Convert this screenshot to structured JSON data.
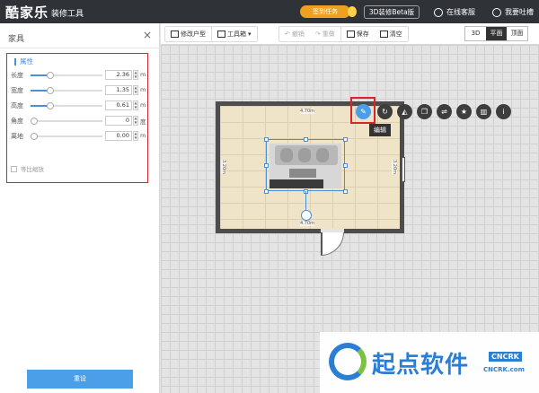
{
  "header": {
    "logo": "酷家乐",
    "subtitle": "装修工具",
    "task_label": "签到任务",
    "beta_label": "3D装修Beta版",
    "service_label": "在线客服",
    "feedback_label": "我要吐槽"
  },
  "left_panel": {
    "title": "家具",
    "close": "×",
    "attr_title": "属性",
    "rows": [
      {
        "label": "长度",
        "value": "2.36",
        "unit": "m",
        "fill": 0.28
      },
      {
        "label": "宽度",
        "value": "1.35",
        "unit": "m",
        "fill": 0.28
      },
      {
        "label": "高度",
        "value": "0.61",
        "unit": "m",
        "fill": 0.28
      },
      {
        "label": "角度",
        "value": "0",
        "unit": "度",
        "fill": 0.0
      },
      {
        "label": "离地",
        "value": "0.00",
        "unit": "m",
        "fill": 0.0
      }
    ],
    "checkbox_label": "等比缩放",
    "reset_label": "重设"
  },
  "toolbar": {
    "edit_floor": "修改户型",
    "toolbox": "工具箱",
    "undo": "撤销",
    "redo": "重做",
    "save": "保存",
    "clear": "清空",
    "view_3d": "3D",
    "view_plan": "平面",
    "view_elev": "顶面"
  },
  "canvas": {
    "dim_top": "4.70m",
    "dim_bottom": "4.70m",
    "dim_left": "3.20m",
    "dim_right": "3.20m",
    "tooltip": "编辑"
  },
  "watermark": {
    "text": "起点软件",
    "badge": "CNCRK",
    "url": "CNCRK.com"
  }
}
